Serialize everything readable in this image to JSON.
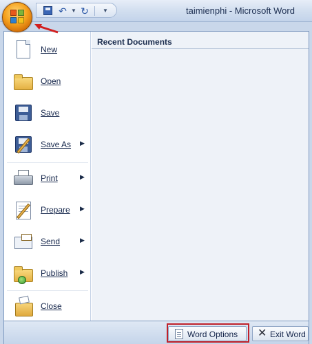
{
  "window": {
    "title": "taimienphi - Microsoft Word"
  },
  "office_button": {
    "icon": "office-logo-icon"
  },
  "quick_access_toolbar": {
    "icons": [
      "save-icon",
      "undo-icon",
      "dropdown-icon",
      "redo-icon",
      "customize-dropdown-icon"
    ]
  },
  "menu": {
    "items": [
      {
        "label": "New",
        "icon": "new-document-icon",
        "submenu": false
      },
      {
        "label": "Open",
        "icon": "open-folder-icon",
        "submenu": false
      },
      {
        "label": "Save",
        "icon": "save-disk-icon",
        "submenu": false
      },
      {
        "label": "Save As",
        "icon": "save-as-icon",
        "submenu": true
      },
      {
        "label": "Print",
        "icon": "printer-icon",
        "submenu": true
      },
      {
        "label": "Prepare",
        "icon": "prepare-document-icon",
        "submenu": true
      },
      {
        "label": "Send",
        "icon": "send-icon",
        "submenu": true
      },
      {
        "label": "Publish",
        "icon": "publish-icon",
        "submenu": true
      },
      {
        "label": "Close",
        "icon": "close-document-icon",
        "submenu": false
      }
    ],
    "submenu_arrow": "▶"
  },
  "recent": {
    "title": "Recent Documents"
  },
  "footer": {
    "options_label": "Word Options",
    "exit_label": "Exit Word",
    "exit_glyph": "✕"
  },
  "colors": {
    "highlight": "#c0202a",
    "arrow": "#d21f1f",
    "office_orange": "#f5a21e"
  }
}
